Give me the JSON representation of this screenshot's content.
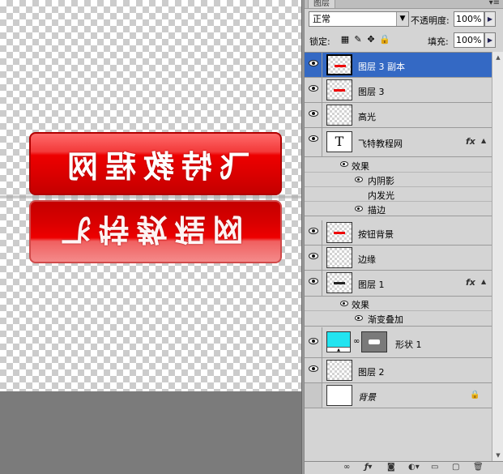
{
  "canvas": {
    "button_text": "飞特教程网",
    "reflection_text": "飞特教程网"
  },
  "panel": {
    "tab_label": "图层",
    "blend_mode": "正常",
    "opacity_label": "不透明度:",
    "opacity_value": "100%",
    "lock_label": "锁定:",
    "fill_label": "填充:",
    "fill_value": "100%"
  },
  "layers": [
    {
      "name": "图层 3 副本",
      "selected": true
    },
    {
      "name": "图层 3"
    },
    {
      "name": "高光"
    },
    {
      "name": "飞特教程网",
      "thumb_glyph": "T"
    },
    {
      "name": "按钮背景"
    },
    {
      "name": "边缘"
    },
    {
      "name": "图层 1"
    },
    {
      "name": "形状 1"
    },
    {
      "name": "图层 2"
    },
    {
      "name": "背景"
    }
  ],
  "effects_text_layer": {
    "group": "效果",
    "items": [
      "内阴影",
      "内发光",
      "描边"
    ]
  },
  "effects_layer1": {
    "group": "效果",
    "items": [
      "渐变叠加"
    ]
  },
  "marks": {
    "fx": "fx",
    "fx2": "fx"
  },
  "colors": {
    "selected_row": "#3469c4",
    "button_red": "#ee0000",
    "shape_cyan": "#22e4f0"
  }
}
